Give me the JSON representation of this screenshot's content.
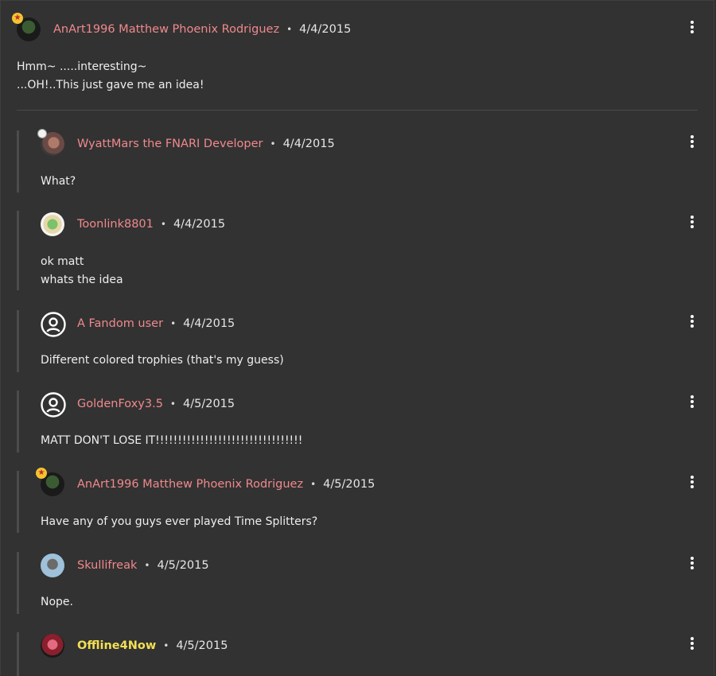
{
  "comments": [
    {
      "author": "AnArt1996 Matthew Phoenix Rodriguez",
      "separator": "•",
      "date": "4/4/2015",
      "lines": [
        "Hmm~ .....interesting~",
        "...OH!..This just gave me an idea!"
      ]
    },
    {
      "author": "WyattMars the FNARI Developer",
      "separator": "•",
      "date": "4/4/2015",
      "lines": [
        "What?"
      ]
    },
    {
      "author": "Toonlink8801",
      "separator": "•",
      "date": "4/4/2015",
      "lines": [
        "ok matt",
        "whats the idea"
      ]
    },
    {
      "author": "A Fandom user",
      "separator": "•",
      "date": "4/4/2015",
      "lines": [
        "Different colored trophies (that's my guess)"
      ]
    },
    {
      "author": "GoldenFoxy3.5",
      "separator": "•",
      "date": "4/5/2015",
      "lines": [
        "MATT DON'T LOSE IT!!!!!!!!!!!!!!!!!!!!!!!!!!!!!!!!!"
      ]
    },
    {
      "author": "AnArt1996 Matthew Phoenix Rodriguez",
      "separator": "•",
      "date": "4/5/2015",
      "lines": [
        "Have any of you guys ever played Time Splitters?"
      ]
    },
    {
      "author": "Skullifreak",
      "separator": "•",
      "date": "4/5/2015",
      "lines": [
        "Nope."
      ]
    },
    {
      "author": "Offline4Now",
      "separator": "•",
      "date": "4/5/2015",
      "lines": []
    }
  ],
  "colors": {
    "background": "#323232",
    "author_link": "#f0898d",
    "special_author": "#f3df55",
    "text": "#eeeeee",
    "reply_bar": "#4c4c4c"
  }
}
